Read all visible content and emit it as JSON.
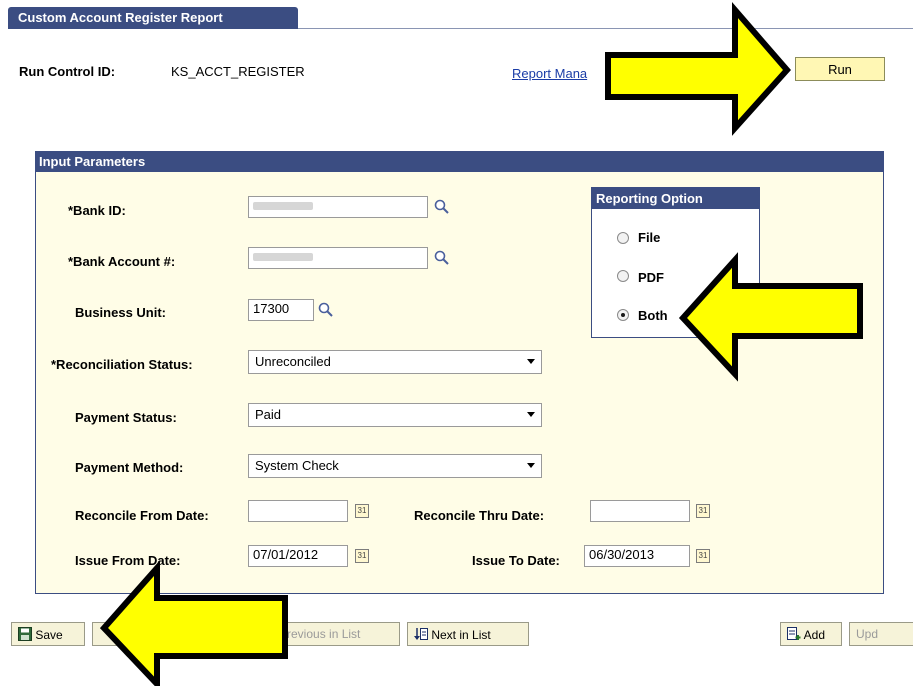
{
  "header": {
    "tab_title": "Custom Account Register Report"
  },
  "run_control": {
    "label": "Run Control ID:",
    "value": "KS_ACCT_REGISTER"
  },
  "links": {
    "report_manager": "Report Mana"
  },
  "buttons": {
    "run": "Run"
  },
  "input_parameters": {
    "title": "Input Parameters",
    "bank_id": {
      "label": "*Bank ID:",
      "value": ""
    },
    "bank_account": {
      "label": "*Bank Account #:",
      "value": ""
    },
    "business_unit": {
      "label": "Business Unit:",
      "value": "17300"
    },
    "reconciliation_status": {
      "label": "*Reconciliation Status:",
      "value": "Unreconciled"
    },
    "payment_status": {
      "label": "Payment Status:",
      "value": "Paid"
    },
    "payment_method": {
      "label": "Payment Method:",
      "value": "System Check"
    },
    "reconcile_from_date": {
      "label": "Reconcile From Date:",
      "value": ""
    },
    "reconcile_thru_date": {
      "label": "Reconcile Thru Date:",
      "value": ""
    },
    "issue_from_date": {
      "label": "Issue From Date:",
      "value": "07/01/2012"
    },
    "issue_to_date": {
      "label": "Issue To Date:",
      "value": "06/30/2013"
    }
  },
  "reporting_option": {
    "title": "Reporting Option",
    "options": [
      "File",
      "PDF",
      "Both"
    ],
    "selected": "Both"
  },
  "toolbar": {
    "save": "Save",
    "previous_in_list": "Previous in List",
    "next_in_list": "Next in List",
    "add": "Add",
    "update": "Upd"
  },
  "colors": {
    "header_blue": "#3b4d82",
    "group_bg": "#fffde7",
    "annotation_arrow": "#ffff00"
  },
  "icons": {
    "lookup": "magnifier-icon",
    "calendar": "calendar-icon",
    "save": "floppy-disk-icon",
    "next": "next-in-list-icon",
    "add": "add-icon"
  }
}
